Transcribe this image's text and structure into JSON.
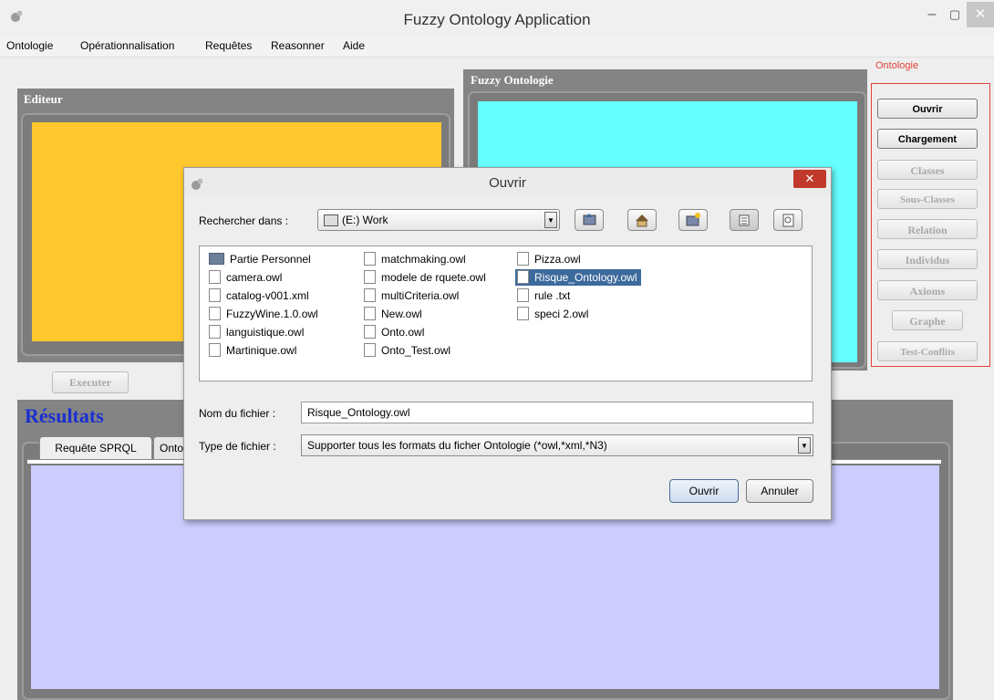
{
  "window": {
    "title": "Fuzzy Ontology Application",
    "min": "–",
    "max": "▢",
    "close": "✕"
  },
  "menu": [
    "Ontologie",
    "Opérationnalisation",
    "Requêtes",
    "Reasonner",
    "Aide"
  ],
  "editor": {
    "title": "Editeur",
    "color": "#ffc82e",
    "execute_label": "Executer"
  },
  "fuzzy": {
    "title": "Fuzzy Ontologie",
    "color": "#66ffff"
  },
  "ontology_group": {
    "label": "Ontologie",
    "border_color": "#e0433a",
    "buttons": [
      "Ouvrir",
      "Chargement",
      "Classes",
      "Sous-Classes",
      "Relation",
      "Individus",
      "Axioms",
      "Graphe",
      "Test-Conflits"
    ]
  },
  "results": {
    "title": "Résultats",
    "title_color": "#1a2fd1",
    "tabs": [
      "Requête SPRQL",
      "Onto"
    ],
    "area_color": "#ccccff"
  },
  "dialog": {
    "title": "Ouvrir",
    "look_in_label": "Rechercher dans :",
    "look_in_value": "(E:) Work",
    "files": [
      {
        "name": "Partie Personnel",
        "type": "folder"
      },
      {
        "name": "camera.owl",
        "type": "file"
      },
      {
        "name": "catalog-v001.xml",
        "type": "file"
      },
      {
        "name": "FuzzyWine.1.0.owl",
        "type": "file"
      },
      {
        "name": "languistique.owl",
        "type": "file"
      },
      {
        "name": "Martinique.owl",
        "type": "file"
      },
      {
        "name": "matchmaking.owl",
        "type": "file"
      },
      {
        "name": "modele de rquete.owl",
        "type": "file"
      },
      {
        "name": "multiCriteria.owl",
        "type": "file"
      },
      {
        "name": "New.owl",
        "type": "file"
      },
      {
        "name": "Onto.owl",
        "type": "file"
      },
      {
        "name": "Onto_Test.owl",
        "type": "file"
      },
      {
        "name": "Pizza.owl",
        "type": "file"
      },
      {
        "name": "Risque_Ontology.owl",
        "type": "file",
        "selected": true
      },
      {
        "name": "rule .txt",
        "type": "file"
      },
      {
        "name": "speci 2.owl",
        "type": "file"
      }
    ],
    "filename_label": "Nom du fichier :",
    "filename_value": "Risque_Ontology.owl",
    "filetype_label": "Type de fichier :",
    "filetype_value": "Supporter tous les  formats du ficher Ontologie (*owl,*xml,*N3)",
    "open_label": "Ouvrir",
    "cancel_label": "Annuler"
  }
}
